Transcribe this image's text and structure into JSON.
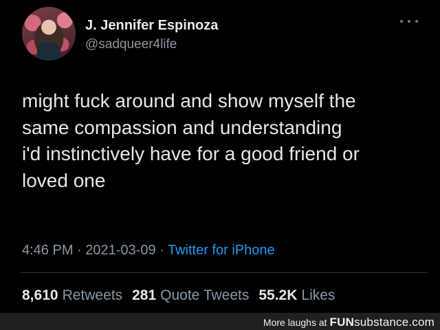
{
  "tweet": {
    "author": {
      "display_name": "J. Jennifer Espinoza",
      "handle": "@sadqueer4life"
    },
    "text_lines": [
      "might fuck around and show myself the",
      "same compassion and understanding",
      "i'd instinctively have for a good friend or",
      "loved one"
    ],
    "meta": {
      "time": "4:46 PM",
      "separator": " · ",
      "date": "2021-03-09",
      "source": "Twitter for iPhone"
    },
    "stats": [
      {
        "count": "8,610",
        "label": "Retweets"
      },
      {
        "count": "281",
        "label": "Quote Tweets"
      },
      {
        "count": "55.2K",
        "label": "Likes"
      }
    ]
  },
  "footer": {
    "prefix": "More laughs at",
    "brand_bold": "FUN",
    "brand_rest": "substance.com"
  },
  "icons": {
    "more": "more-horizontal-icon",
    "avatar": "profile-photo"
  },
  "colors": {
    "background": "#000000",
    "link": "#1d9bf0",
    "secondary_text": "#8b98a5"
  }
}
